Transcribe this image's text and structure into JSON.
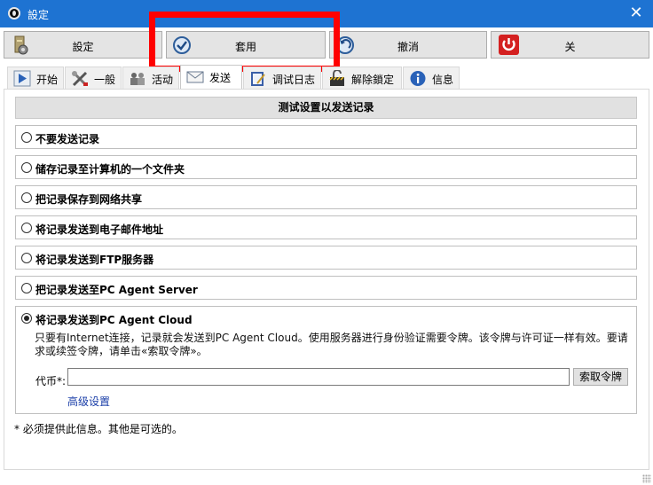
{
  "window": {
    "title": "設定",
    "close_glyph": "✕"
  },
  "toolbar": {
    "settings_label": "設定",
    "apply_label": "套用",
    "cancel_label": "撤消",
    "close_label": "关"
  },
  "tabs": [
    {
      "label": "开始",
      "icon": "play-icon"
    },
    {
      "label": "一般",
      "icon": "tools-icon"
    },
    {
      "label": "活动",
      "icon": "people-icon"
    },
    {
      "label": "发送",
      "icon": "mail-icon"
    },
    {
      "label": "调试日志",
      "icon": "log-icon"
    },
    {
      "label": "解除鎖定",
      "icon": "unlock-icon"
    },
    {
      "label": "信息",
      "icon": "info-icon"
    }
  ],
  "section_title": "测试设置以发送记录",
  "options": [
    {
      "label": "不要发送记录",
      "selected": false
    },
    {
      "label": "储存记录至计算机的一个文件夹",
      "selected": false
    },
    {
      "label": "把记录保存到网络共享",
      "selected": false
    },
    {
      "label": "将记录发送到电子邮件地址",
      "selected": false
    },
    {
      "label": "将记录发送到FTP服务器",
      "selected": false
    },
    {
      "label": "把记录发送至PC Agent Server",
      "selected": false
    },
    {
      "label": "将记录发送到PC Agent Cloud",
      "selected": true
    }
  ],
  "cloud": {
    "description": "只要有Internet连接，记录就会发送到PC Agent Cloud。使用服务器进行身份验证需要令牌。该令牌与许可证一样有效。要请求或续签令牌，请单击«索取令牌»。",
    "token_label": "代币*:",
    "token_value": "",
    "request_token_label": "索取令牌",
    "advanced_link": "高级设置"
  },
  "footnote": "* 必须提供此信息。其他是可选的。",
  "colors": {
    "titlebar": "#1e73d2",
    "link": "#1a3ea8",
    "highlight": "#ff0000"
  }
}
